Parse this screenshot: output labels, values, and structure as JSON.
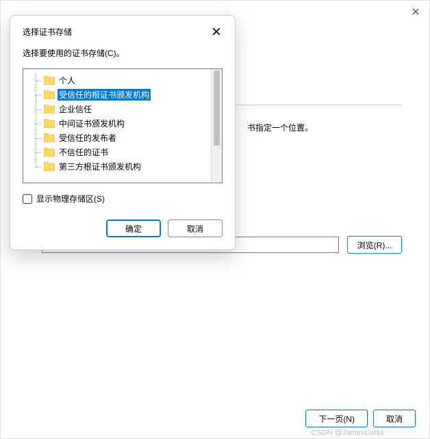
{
  "wizard": {
    "hint_fragment": "书指定一个位置。",
    "browse_label": "浏览(R)...",
    "next_label": "下一页(N)",
    "cancel_label": "取消"
  },
  "modal": {
    "title": "选择证书存储",
    "instruction": "选择要使用的证书存储(C)。",
    "tree": [
      {
        "label": "个人",
        "selected": false
      },
      {
        "label": "受信任的根证书颁发机构",
        "selected": true
      },
      {
        "label": "企业信任",
        "selected": false
      },
      {
        "label": "中间证书颁发机构",
        "selected": false
      },
      {
        "label": "受信任的发布者",
        "selected": false
      },
      {
        "label": "不信任的证书",
        "selected": false
      },
      {
        "label": "第三方根证书颁发机构",
        "selected": false
      }
    ],
    "checkbox_label": "显示物理存储区(S)",
    "ok_label": "确定",
    "cancel_label": "取消"
  },
  "attribution": "CSDN @JamesCurtis"
}
